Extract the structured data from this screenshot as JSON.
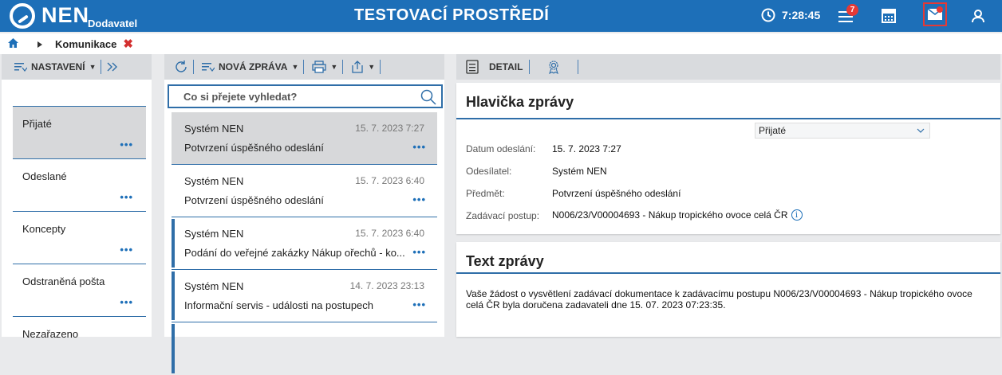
{
  "topbar": {
    "logo_text": "NEN",
    "logo_sub": "Dodavatel",
    "env_title": "TESTOVACÍ PROSTŘEDÍ",
    "clock_time": "7:28:45",
    "menu_badge": "7",
    "brand_color": "#1d6fb8",
    "icons": [
      "clock-icon",
      "menu-icon",
      "calculator-icon",
      "mail-icon",
      "user-icon"
    ]
  },
  "breadcrumb": {
    "label": "Komunikace"
  },
  "left_toolbar": {
    "settings_label": "NASTAVENÍ"
  },
  "folders": [
    {
      "label": "Přijaté",
      "active": true
    },
    {
      "label": "Odeslané",
      "active": false
    },
    {
      "label": "Koncepty",
      "active": false
    },
    {
      "label": "Odstraněná pošta",
      "active": false
    },
    {
      "label": "Nezařazeno",
      "active": false
    }
  ],
  "mid_toolbar": {
    "new_message_label": "NOVÁ ZPRÁVA"
  },
  "search": {
    "placeholder": "Co si přejete vyhledat?"
  },
  "messages": [
    {
      "sender": "Systém NEN",
      "date": "15. 7. 2023 7:27",
      "subject": "Potvrzení úspěšného odeslání",
      "active": true,
      "unread": false
    },
    {
      "sender": "Systém NEN",
      "date": "15. 7. 2023 6:40",
      "subject": "Potvrzení úspěšného odeslání",
      "active": false,
      "unread": false
    },
    {
      "sender": "Systém NEN",
      "date": "15. 7. 2023 6:40",
      "subject": "Podání do veřejné zakázky Nákup ořechů - ko...",
      "active": false,
      "unread": true
    },
    {
      "sender": "Systém NEN",
      "date": "14. 7. 2023 23:13",
      "subject": "Informační servis - události na postupech",
      "active": false,
      "unread": true
    },
    {
      "sender": "",
      "date": "",
      "subject": "",
      "active": false,
      "unread": true
    }
  ],
  "right_toolbar": {
    "detail_label": "DETAIL"
  },
  "header_card": {
    "title": "Hlavička zprávy",
    "folder_select": "Přijaté",
    "fields": [
      {
        "label": "Datum odeslání:",
        "value": "15. 7. 2023 7:27"
      },
      {
        "label": "Odesílatel:",
        "value": "Systém NEN"
      },
      {
        "label": "Předmět:",
        "value": "Potvrzení úspěšného odeslání"
      },
      {
        "label": "Zadávací postup:",
        "value": "N006/23/V00004693 - Nákup tropického ovoce celá ČR"
      }
    ]
  },
  "text_card": {
    "title": "Text zprávy",
    "body": "Vaše žádost o vysvětlení zadávací dokumentace k zadávacímu postupu N006/23/V00004693 - Nákup tropického ovoce celá ČR byla doručena zadavateli dne 15. 07. 2023 07:23:35."
  }
}
